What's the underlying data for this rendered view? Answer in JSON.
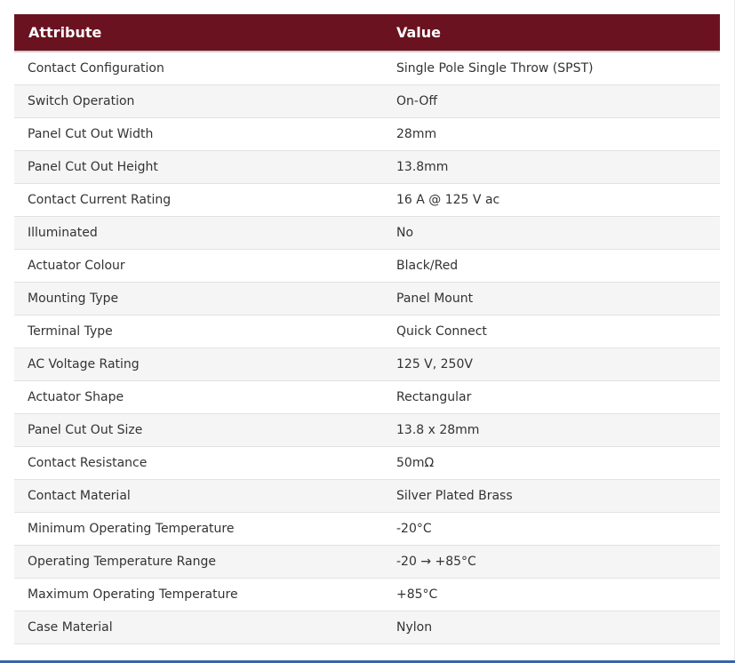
{
  "table": {
    "headers": {
      "attribute": "Attribute",
      "value": "Value"
    },
    "rows": [
      {
        "attribute": "Contact Configuration",
        "value": "Single Pole Single Throw (SPST)"
      },
      {
        "attribute": "Switch Operation",
        "value": "On-Off"
      },
      {
        "attribute": "Panel Cut Out Width",
        "value": "28mm"
      },
      {
        "attribute": "Panel Cut Out Height",
        "value": "13.8mm"
      },
      {
        "attribute": "Contact Current Rating",
        "value": "16 A @ 125 V ac"
      },
      {
        "attribute": "Illuminated",
        "value": "No"
      },
      {
        "attribute": "Actuator Colour",
        "value": "Black/Red"
      },
      {
        "attribute": "Mounting Type",
        "value": "Panel Mount"
      },
      {
        "attribute": "Terminal Type",
        "value": "Quick Connect"
      },
      {
        "attribute": "AC Voltage Rating",
        "value": "125 V, 250V"
      },
      {
        "attribute": "Actuator Shape",
        "value": "Rectangular"
      },
      {
        "attribute": "Panel Cut Out Size",
        "value": "13.8 x 28mm"
      },
      {
        "attribute": "Contact Resistance",
        "value": "50mΩ"
      },
      {
        "attribute": "Contact Material",
        "value": "Silver Plated Brass"
      },
      {
        "attribute": "Minimum Operating Temperature",
        "value": "-20°C"
      },
      {
        "attribute": "Operating Temperature Range",
        "value": "-20 → +85°C"
      },
      {
        "attribute": "Maximum Operating Temperature",
        "value": "+85°C"
      },
      {
        "attribute": "Case Material",
        "value": "Nylon"
      }
    ]
  },
  "colors": {
    "header_background": "#6b1220",
    "header_text": "#ffffff",
    "row_alt_background": "#f5f5f5",
    "body_text": "#333333",
    "bottom_bar": "#3a63a8"
  }
}
